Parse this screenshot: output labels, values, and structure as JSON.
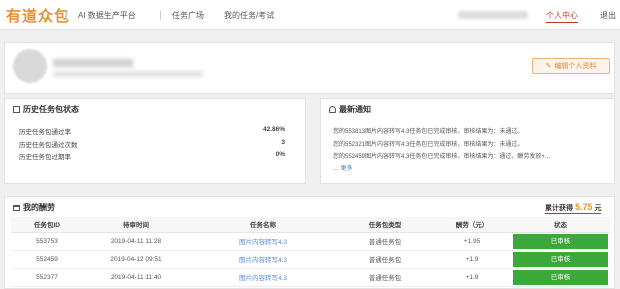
{
  "header": {
    "logo": "有道众包",
    "nav": [
      "AI 数据生产平台",
      "任务广场",
      "我的任务/考试"
    ],
    "user_center": "个人中心",
    "logout": "退出"
  },
  "profile": {
    "edit_button": "编辑个人资料"
  },
  "history": {
    "title": "历史任务包状态",
    "rows": [
      {
        "label": "历史任务包通过率",
        "value": "42.86%"
      },
      {
        "label": "历史任务包通过次数",
        "value": "3"
      },
      {
        "label": "历史任务包过期率",
        "value": "0%"
      }
    ]
  },
  "news": {
    "title": "最新通知",
    "items": [
      "您的553813图片内容转写4.3任务包已完成审核，审核结果为：未通过。",
      "您的552321图片内容转写4.3任务包已完成审核，审核结果为：未通过。",
      "您的552459图片内容转写4.3任务包已完成审核，审核结果为：通过，酬劳发放+..."
    ],
    "ellipsis": "…",
    "more": "更多"
  },
  "earnings": {
    "title": "我的酬劳",
    "total_label": "累计获得",
    "total_value": "5.75",
    "total_unit": "元",
    "columns": [
      "任务包ID",
      "待审时间",
      "任务名称",
      "任务包类型",
      "酬劳（元）",
      "状态"
    ],
    "rows": [
      {
        "id": "553753",
        "time": "2019-04-11 11:28",
        "name": "图片内容转写4.3",
        "type": "普通任务包",
        "pay": "+1.95",
        "status": "已审核"
      },
      {
        "id": "552459",
        "time": "2019-04-12 09:51",
        "name": "图片内容转写4.3",
        "type": "普通任务包",
        "pay": "+1.9",
        "status": "已审核"
      },
      {
        "id": "552377",
        "time": "2019-04-11 11:40",
        "name": "图片内容转写4.3",
        "type": "普通任务包",
        "pay": "+1.9",
        "status": "已审核"
      }
    ]
  }
}
